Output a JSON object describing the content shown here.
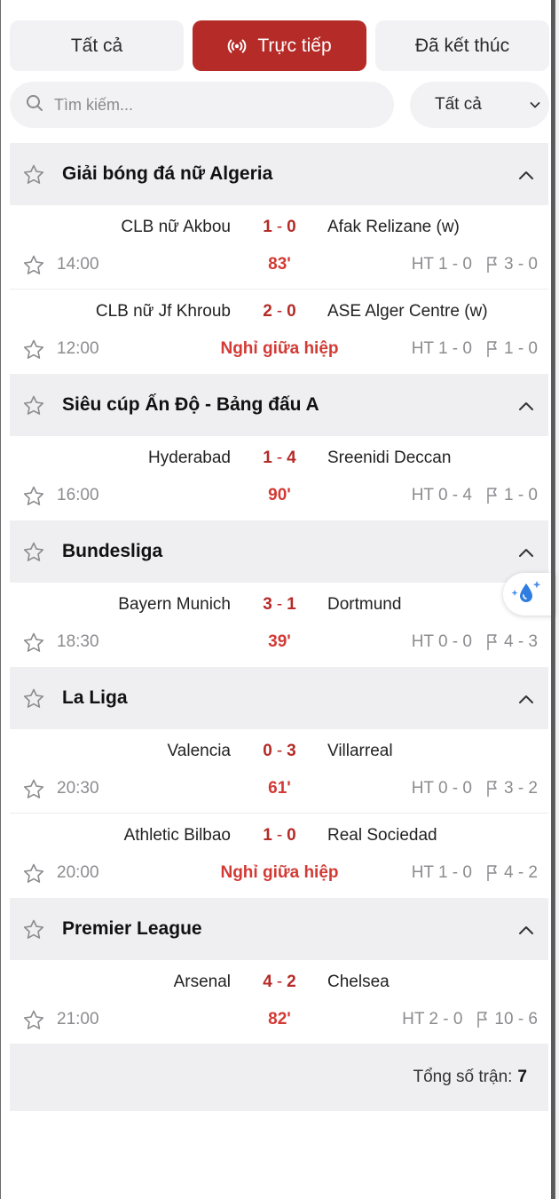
{
  "tabs": [
    {
      "label": "Tất cả",
      "active": false
    },
    {
      "label": "Trực tiếp",
      "active": true
    },
    {
      "label": "Đã kết thúc",
      "active": false
    }
  ],
  "search": {
    "placeholder": "Tìm kiếm...",
    "value": ""
  },
  "filter": {
    "selected": "Tất cả"
  },
  "colors": {
    "accent": "#b52b27",
    "status": "#d23a35",
    "muted": "#8c8c90"
  },
  "leagues": [
    {
      "name": "Giải bóng đá nữ Algeria",
      "matches": [
        {
          "home": "CLB nữ Akbou",
          "home_score": "1",
          "away_score": "0",
          "away": "Afak Relizane (w)",
          "time": "14:00",
          "status": "83'",
          "ht": "HT 1 - 0",
          "corners": "3 - 0"
        },
        {
          "home": "CLB nữ Jf Khroub",
          "home_score": "2",
          "away_score": "0",
          "away": "ASE Alger Centre (w)",
          "time": "12:00",
          "status": "Nghỉ giữa hiệp",
          "ht": "HT 1 - 0",
          "corners": "1 - 0"
        }
      ]
    },
    {
      "name": "Siêu cúp Ấn Độ - Bảng đấu A",
      "matches": [
        {
          "home": "Hyderabad",
          "home_score": "1",
          "away_score": "4",
          "away": "Sreenidi Deccan",
          "time": "16:00",
          "status": "90'",
          "ht": "HT 0 - 4",
          "corners": "1 - 0"
        }
      ]
    },
    {
      "name": "Bundesliga",
      "matches": [
        {
          "home": "Bayern Munich",
          "home_score": "3",
          "away_score": "1",
          "away": "Dortmund",
          "time": "18:30",
          "status": "39'",
          "ht": "HT 0 - 0",
          "corners": "4 - 3"
        }
      ]
    },
    {
      "name": "La Liga",
      "matches": [
        {
          "home": "Valencia",
          "home_score": "0",
          "away_score": "3",
          "away": "Villarreal",
          "time": "20:30",
          "status": "61'",
          "ht": "HT 0 - 0",
          "corners": "3 - 2"
        },
        {
          "home": "Athletic Bilbao",
          "home_score": "1",
          "away_score": "0",
          "away": "Real Sociedad",
          "time": "20:00",
          "status": "Nghỉ giữa hiệp",
          "ht": "HT 1 - 0",
          "corners": "4 - 2"
        }
      ]
    },
    {
      "name": "Premier League",
      "matches": [
        {
          "home": "Arsenal",
          "home_score": "4",
          "away_score": "2",
          "away": "Chelsea",
          "time": "21:00",
          "status": "82'",
          "ht": "HT 2 - 0",
          "corners": "10 - 6"
        }
      ]
    }
  ],
  "total": {
    "label": "Tổng số trận:",
    "count": "7"
  },
  "icons": {
    "live": "broadcast-icon",
    "search": "search-icon",
    "filter_chevron": "chevron-down-icon",
    "favorite": "star-icon",
    "collapse": "chevron-up-icon",
    "corner": "flag-icon",
    "assistant": "sparkle-drop-icon"
  }
}
